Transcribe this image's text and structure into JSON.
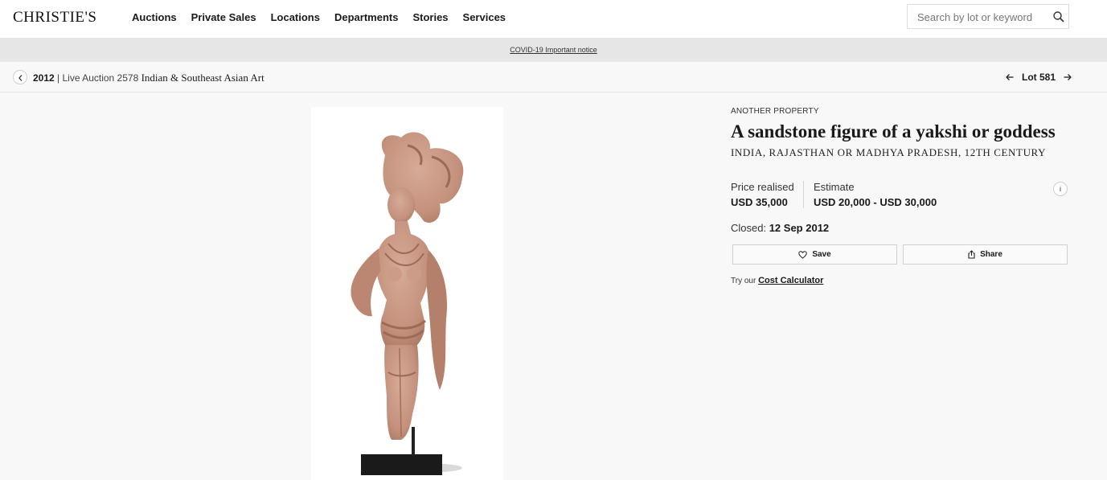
{
  "header": {
    "logo": "CHRISTIE'S",
    "nav": [
      "Auctions",
      "Private Sales",
      "Locations",
      "Departments",
      "Stories",
      "Services"
    ],
    "search": {
      "placeholder": "Search by lot or keyword",
      "icon": "search-icon"
    }
  },
  "notice": {
    "link_text": "COVID-19 Important notice"
  },
  "breadcrumb": {
    "year": "2012",
    "separator": " | ",
    "sale_info": "Live Auction 2578 ",
    "sale_title": "Indian & Southeast Asian Art",
    "lot_label": "Lot 581"
  },
  "lot": {
    "provenance": "ANOTHER PROPERTY",
    "title": "A sandstone figure of a yakshi or goddess",
    "subtitle": "INDIA, RAJASTHAN OR MADHYA PRADESH, 12TH CENTURY",
    "price_realised_label": "Price realised",
    "price_realised_value": "USD 35,000",
    "estimate_label": "Estimate",
    "estimate_value": "USD 20,000 - USD 30,000",
    "closed_label": "Closed: ",
    "closed_date": "12 Sep 2012",
    "save_label": "Save",
    "share_label": "Share",
    "calculator_prefix": "Try our ",
    "calculator_link": "Cost Calculator",
    "info_glyph": "i"
  },
  "colors": {
    "background": "#f8f8f8",
    "notice_bar": "#e6e6e6",
    "sandstone": "#c99a86",
    "stand": "#1a1a1a"
  }
}
